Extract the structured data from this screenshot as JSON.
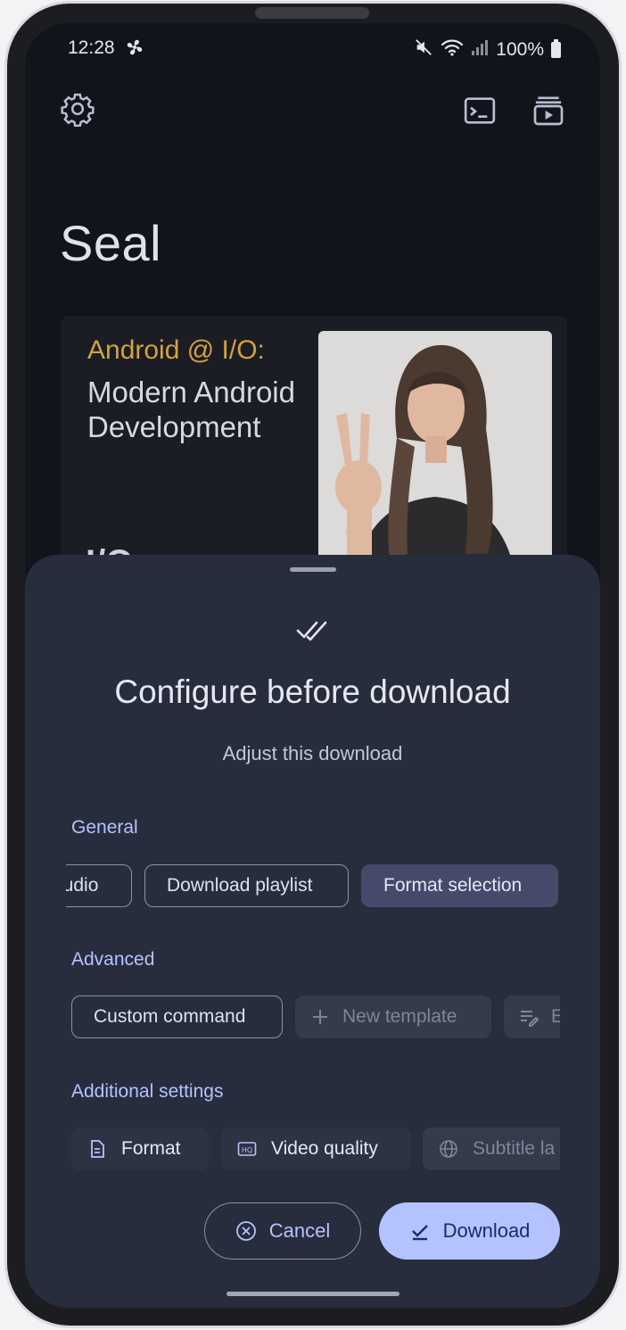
{
  "status_bar": {
    "time": "12:28",
    "battery": "100%"
  },
  "app": {
    "title": "Seal"
  },
  "video_card": {
    "label": "Android @ I/O:",
    "headline": "Modern Android Development",
    "logo": "I/O"
  },
  "sheet": {
    "title": "Configure before download",
    "subtitle": "Adjust this download",
    "general": {
      "label": "General",
      "chips": [
        "audio",
        "Download playlist",
        "Format selection"
      ]
    },
    "advanced": {
      "label": "Advanced",
      "chips": [
        "Custom command",
        "New template",
        "E"
      ]
    },
    "additional": {
      "label": "Additional settings",
      "chips": [
        "Format",
        "Video quality",
        "Subtitle la"
      ]
    },
    "cancel_label": "Cancel",
    "download_label": "Download"
  },
  "colors": {
    "accent": "#b4c3ff",
    "sheet_bg": "#282d3d",
    "screen_bg": "#12141c",
    "selected_chip": "#464a6a",
    "card_label": "#d4a13e"
  },
  "icons": {
    "statusbar": [
      "fan-icon",
      "mute-icon",
      "wifi-icon",
      "signal-icon",
      "battery-icon"
    ],
    "toolbar": [
      "gear-icon",
      "terminal-icon",
      "playlist-icon"
    ],
    "sheet": [
      "double-check-icon",
      "plus-icon",
      "edit-list-icon",
      "file-icon",
      "hq-icon",
      "globe-icon",
      "cancel-circle-icon",
      "check-icon"
    ]
  }
}
